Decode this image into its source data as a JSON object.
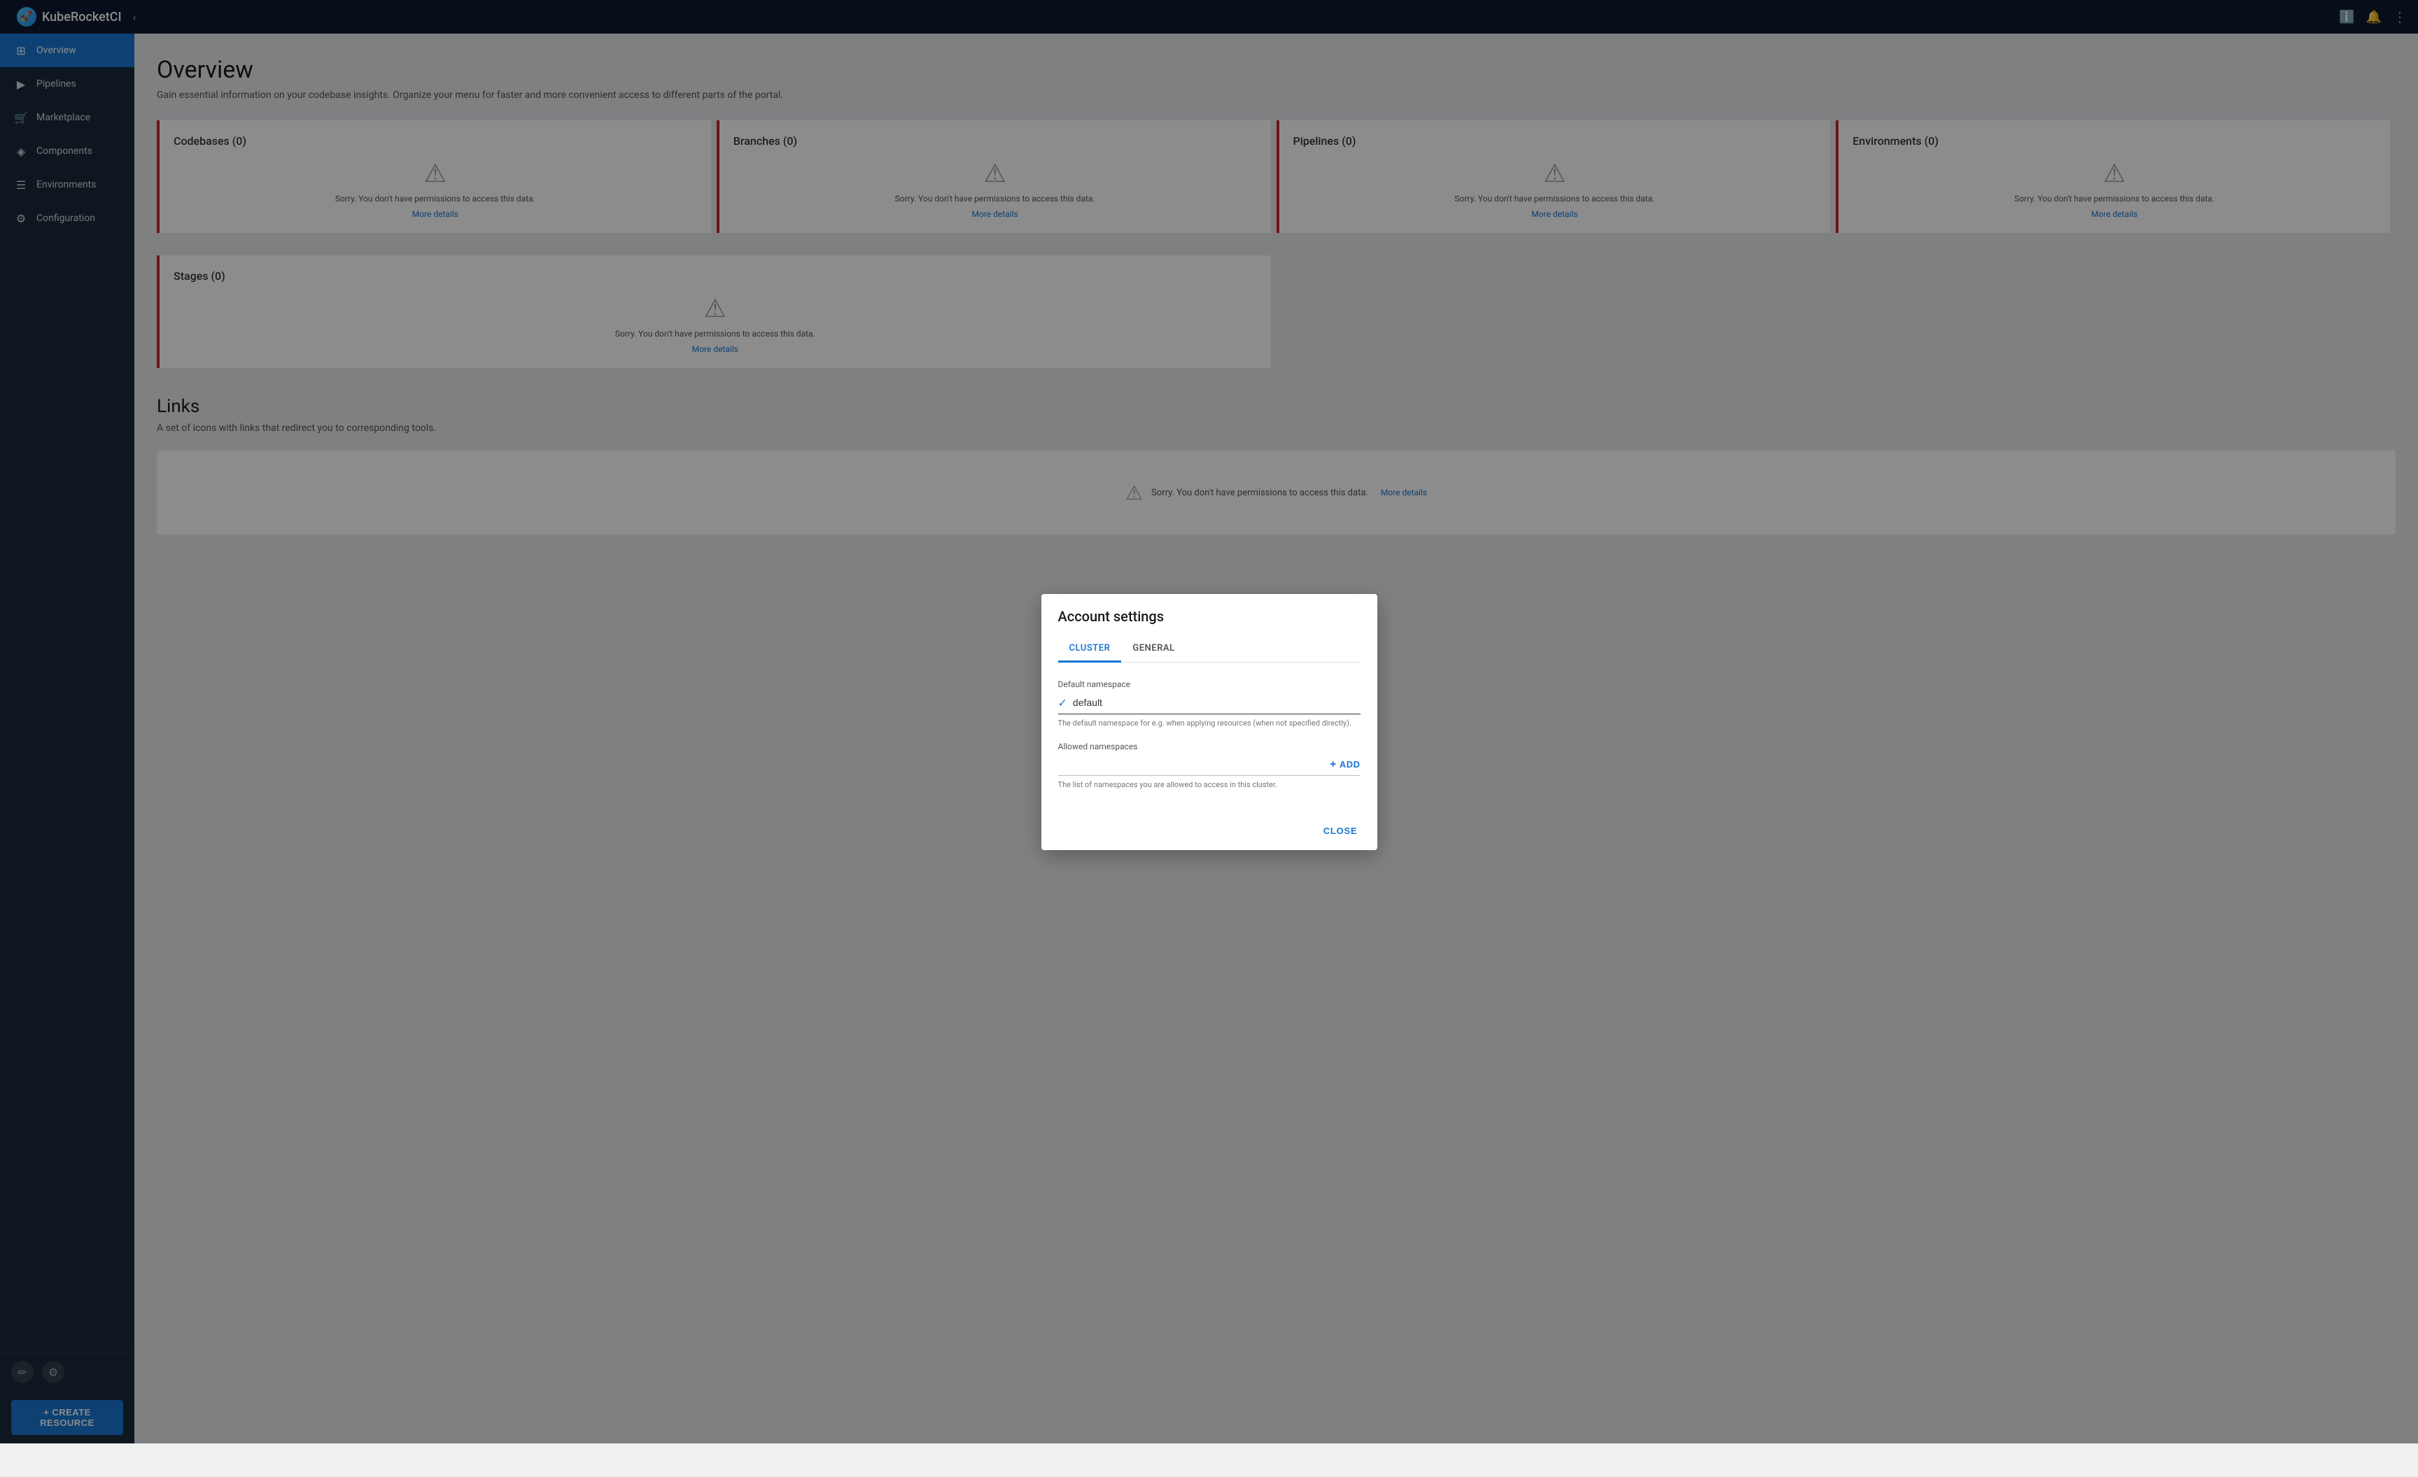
{
  "navbar": {
    "brand": "KubeRocketCI",
    "collapse_icon": "‹",
    "info_icon": "ℹ",
    "bell_icon": "🔔",
    "more_icon": "⋮"
  },
  "sidebar": {
    "items": [
      {
        "id": "overview",
        "label": "Overview",
        "icon": "⊞",
        "active": true
      },
      {
        "id": "pipelines",
        "label": "Pipelines",
        "icon": "▶"
      },
      {
        "id": "marketplace",
        "label": "Marketplace",
        "icon": "🛒"
      },
      {
        "id": "components",
        "label": "Components",
        "icon": "◈"
      },
      {
        "id": "environments",
        "label": "Environments",
        "icon": "☰"
      },
      {
        "id": "configuration",
        "label": "Configuration",
        "icon": "⚙"
      }
    ],
    "bottom_icons": [
      "✏",
      "⚙"
    ],
    "create_button": "+ CREATE RESOURCE"
  },
  "main": {
    "title": "Overview",
    "subtitle": "Gain essential information on your codebase insights. Organize your menu for faster and more convenient access to different parts of the portal.",
    "cards": [
      {
        "title": "Codebases (0)",
        "error": "Sorry. You don't have permissions to access this data.",
        "link": "More details"
      },
      {
        "title": "Branches (0)",
        "error": "Sorry. You don't have permissions to access this data.",
        "link": "More details"
      },
      {
        "title": "Pipelines (0)",
        "error": "Sorry. You don't have permissions to access this data.",
        "link": "More details"
      },
      {
        "title": "Environments (0)",
        "error": "Sorry. You don't have permissions to access this data.",
        "link": "More details"
      }
    ],
    "cards_row2": [
      {
        "title": "Stages (0)",
        "error": "Sorry. You don't have permissions to access this data.",
        "link": "More details"
      }
    ],
    "links_section": {
      "title": "Links",
      "subtitle": "A set of icons with links that redirect you to corresponding tools.",
      "error": "Sorry. You don't have permissions to access this data.",
      "link": "More details"
    }
  },
  "modal": {
    "title": "Account settings",
    "tabs": [
      {
        "id": "cluster",
        "label": "CLUSTER",
        "active": true
      },
      {
        "id": "general",
        "label": "GENERAL",
        "active": false
      }
    ],
    "cluster_tab": {
      "default_namespace_label": "Default namespace",
      "default_namespace_value": "default",
      "default_namespace_hint": "The default namespace for e.g. when applying resources (when not specified directly).",
      "allowed_namespaces_label": "Allowed namespaces",
      "allowed_namespaces_hint": "The list of namespaces you are allowed to access in this cluster.",
      "add_label": "ADD"
    },
    "close_button": "CLOSE"
  }
}
